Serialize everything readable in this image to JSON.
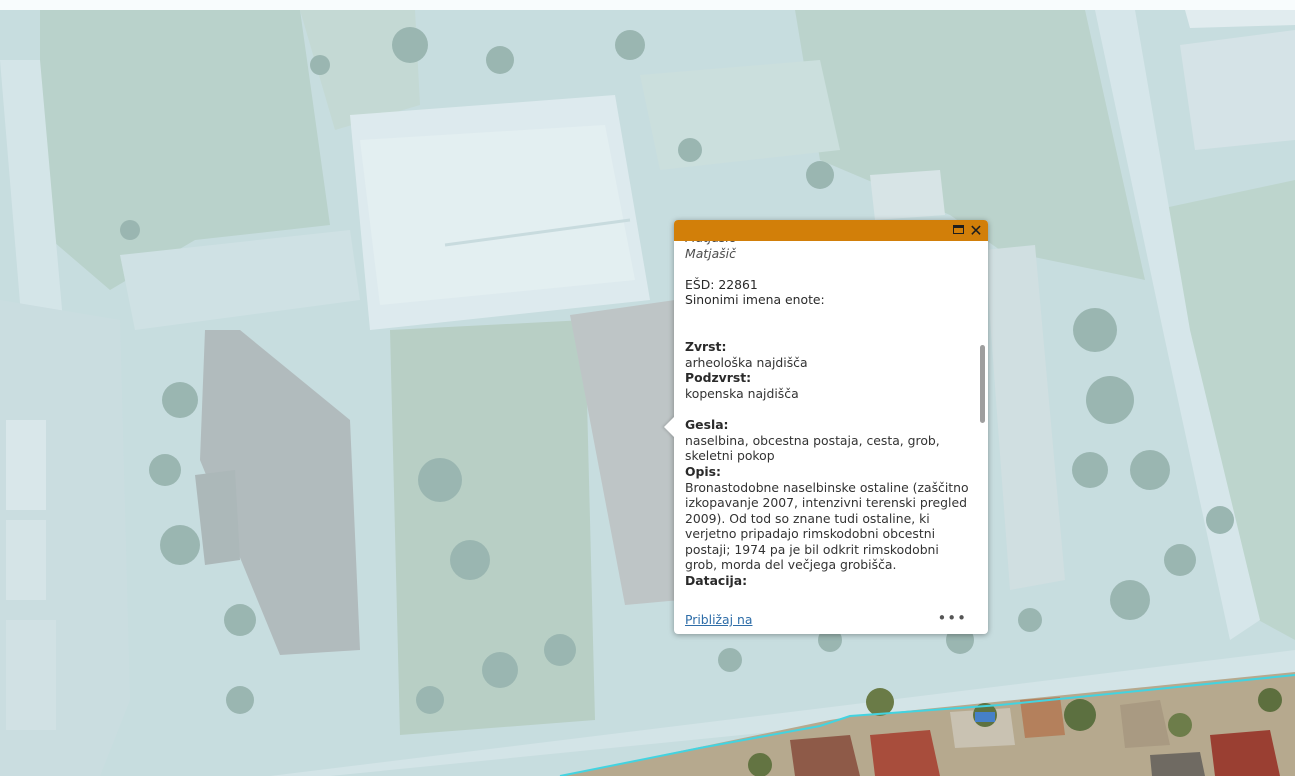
{
  "map": {
    "basemap": "aerial-imagery",
    "overlay_color": "#d6edf4",
    "boundary_color": "#43d3e0"
  },
  "popup": {
    "header_color": "#d27f09",
    "maximize_icon": "window-maximize-icon",
    "close_icon": "close-icon",
    "close_symbol": "✕",
    "author_line": "Matjašič",
    "esd": "EŠD: 22861",
    "synonyms": "Sinonimi imena enote:",
    "zvrst_label": "Zvrst:",
    "zvrst_value": "arheološka najdišča",
    "podzvrst_label": "Podzvrst:",
    "podzvrst_value": "kopenska najdišča",
    "gesla_label": "Gesla:",
    "gesla_value": "naselbina, obcestna postaja, cesta, grob, skeletni pokop",
    "opis_label": "Opis:",
    "opis_value": "Bronastodobne naselbinske ostaline (zaščitno izkopavanje 2007, intenzivni terenski pregled 2009). Od tod so znane tudi ostaline, ki verjetno pripadajo rimskodobni obcestni postaji; 1974 pa je bil odkrit rimskodobni grob, morda del večjega grobišča.",
    "datacija_label": "Datacija:",
    "zoom_link": "Približaj na",
    "more_icon": "more-dots-icon",
    "more_symbol": "•••"
  }
}
